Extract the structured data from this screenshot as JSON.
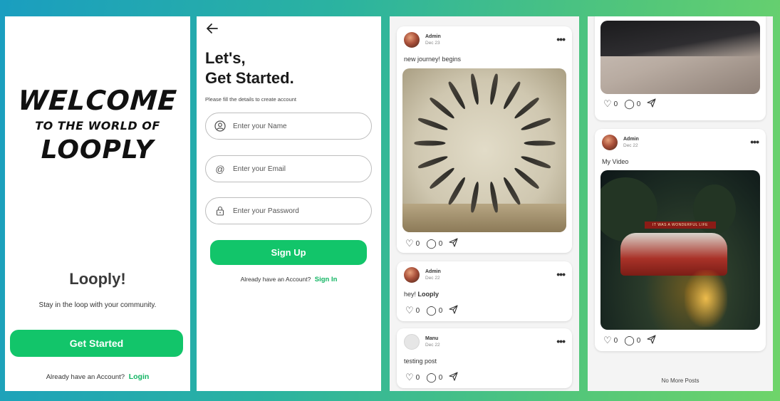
{
  "screen1": {
    "logo_line1": "WELCOME",
    "logo_line2": "TO THE WORLD OF",
    "logo_line3": "LOOPLY",
    "app_name": "Looply!",
    "tagline": "Stay in the loop with your community.",
    "get_started": "Get Started",
    "have_account": "Already have an Account?",
    "login": "Login"
  },
  "screen2": {
    "title_line1": "Let's,",
    "title_line2": "Get Started.",
    "subtitle": "Please fill the details to create account",
    "name_placeholder": "Enter your Name",
    "email_placeholder": "Enter your Email",
    "password_placeholder": "Enter your Password",
    "signup": "Sign Up",
    "have_account": "Already have an Account?",
    "signin": "Sign In"
  },
  "screen3": {
    "posts": [
      {
        "author": "Admin",
        "date": "Dec 23",
        "text": "new journey! begins",
        "likes": "0",
        "comments": "0"
      },
      {
        "author": "Admin",
        "date": "Dec 22",
        "text_prefix": "hey!",
        "text_bold": "Looply",
        "likes": "0",
        "comments": "0"
      },
      {
        "author": "Manu",
        "date": "Dec 22",
        "text": "testing post",
        "likes": "0",
        "comments": "0"
      }
    ]
  },
  "screen4": {
    "posts": [
      {
        "likes": "0",
        "comments": "0"
      },
      {
        "author": "Admin",
        "date": "Dec 22",
        "text": "My Video",
        "likes": "0",
        "comments": "0",
        "sign_text": "IT WAS A WONDERFUL LIFE"
      }
    ],
    "no_more": "No More Posts"
  },
  "colors": {
    "accent": "#12c56a",
    "link": "#12b563"
  },
  "icons": [
    "back-arrow-icon",
    "user-icon",
    "at-icon",
    "lock-icon",
    "heart-icon",
    "comment-icon",
    "send-icon",
    "more-icon"
  ]
}
